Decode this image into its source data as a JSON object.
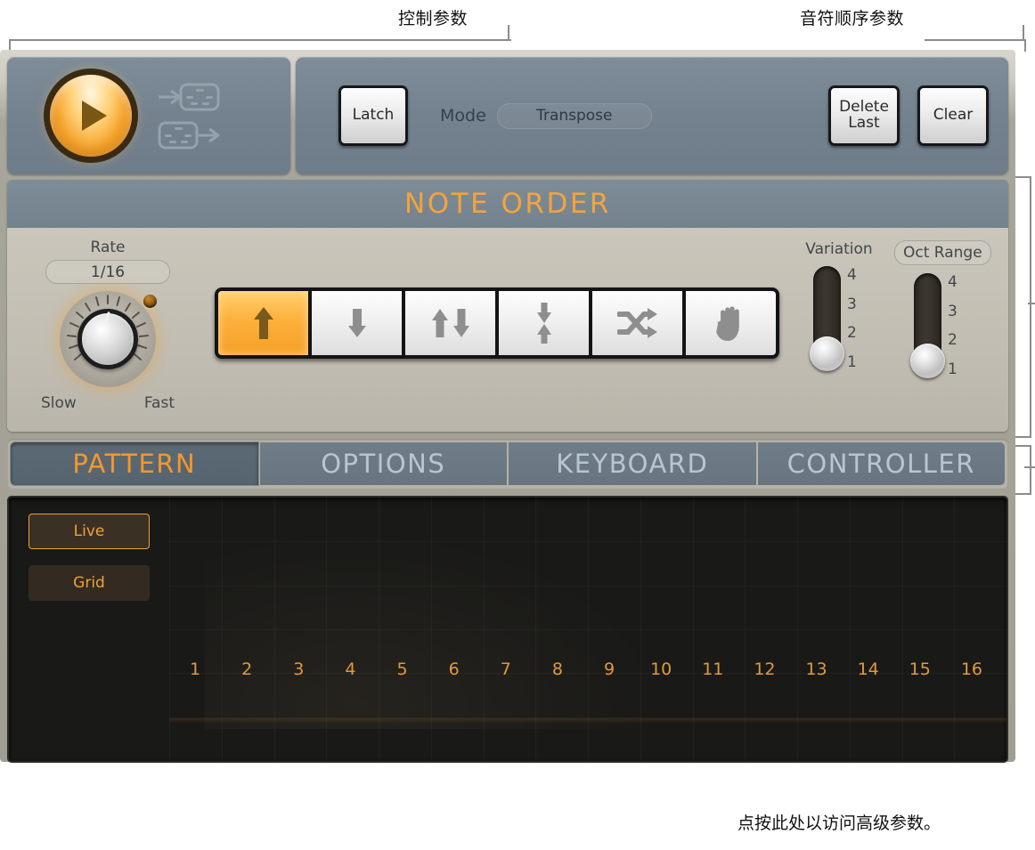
{
  "annotations": {
    "control_params": "控制参数",
    "note_order_params": "音符顺序参数",
    "advanced_hint": "点按此处以访问高级参数。"
  },
  "transport": {
    "play_icon": "play-icon",
    "midi_in_icon": "midi-in-icon",
    "midi_out_icon": "midi-out-icon"
  },
  "control_bar": {
    "latch_label": "Latch",
    "mode_label": "Mode",
    "mode_value": "Transpose",
    "delete_last_label_line1": "Delete",
    "delete_last_label_line2": "Last",
    "clear_label": "Clear"
  },
  "note_order": {
    "title": "NOTE ORDER",
    "rate": {
      "label": "Rate",
      "value": "1/16",
      "min_label": "Slow",
      "max_label": "Fast"
    },
    "directions": [
      {
        "name": "up",
        "icon": "arrow-up-icon",
        "active": true
      },
      {
        "name": "down",
        "icon": "arrow-down-icon",
        "active": false
      },
      {
        "name": "up-down",
        "icon": "arrow-up-down-icon",
        "active": false
      },
      {
        "name": "outside-in",
        "icon": "arrow-inward-icon",
        "active": false
      },
      {
        "name": "random",
        "icon": "shuffle-icon",
        "active": false
      },
      {
        "name": "manual",
        "icon": "hand-icon",
        "active": false
      }
    ],
    "variation": {
      "label": "Variation",
      "ticks": [
        "4",
        "3",
        "2",
        "1"
      ],
      "value": "1"
    },
    "oct_range": {
      "label": "Oct Range",
      "ticks": [
        "4",
        "3",
        "2",
        "1"
      ],
      "value": "1"
    }
  },
  "tabs": [
    {
      "label": "PATTERN",
      "active": true
    },
    {
      "label": "OPTIONS",
      "active": false
    },
    {
      "label": "KEYBOARD",
      "active": false
    },
    {
      "label": "CONTROLLER",
      "active": false
    }
  ],
  "pattern": {
    "live_label": "Live",
    "grid_label": "Grid",
    "arrow_icon": "arrow-down-icon",
    "steps": [
      "1",
      "2",
      "3",
      "4",
      "5",
      "6",
      "7",
      "8",
      "9",
      "10",
      "11",
      "12",
      "13",
      "14",
      "15",
      "16"
    ]
  },
  "colors": {
    "accent_orange": "#f5a33a",
    "panel_blue": "#74828f",
    "body_tan": "#a8a69a",
    "dark_panel": "#191917"
  }
}
